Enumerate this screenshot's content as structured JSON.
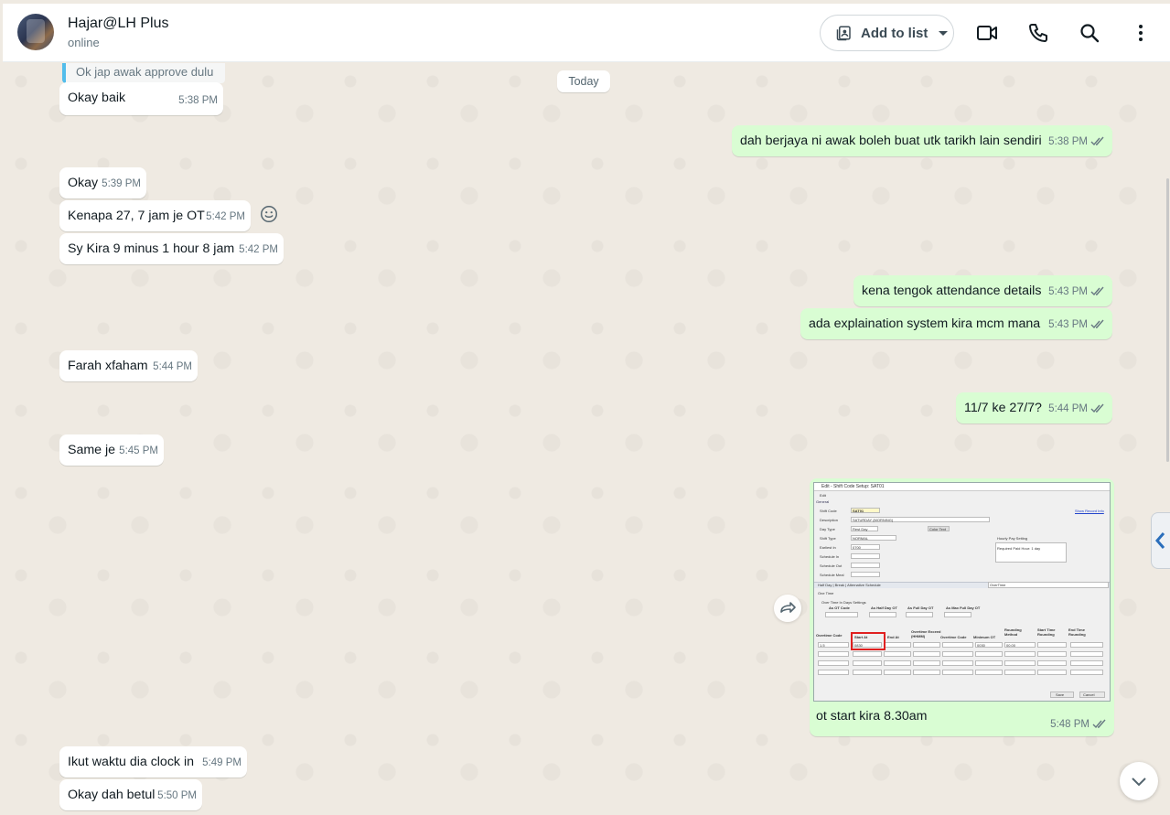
{
  "header": {
    "contact_name": "Hajar@LH Plus",
    "status": "online",
    "add_to_list_label": "Add to list",
    "icons": [
      "video-call-icon",
      "voice-call-icon",
      "search-icon",
      "menu-icon"
    ]
  },
  "chat": {
    "date_separator": "Today",
    "quoted_text": "Ok jap awak approve dulu",
    "messages": [
      {
        "dir": "in",
        "text": "Okay baik",
        "time": "5:38 PM"
      },
      {
        "dir": "out",
        "text": "dah berjaya ni awak boleh buat utk tarikh lain sendiri",
        "time": "5:38 PM"
      },
      {
        "dir": "in",
        "text": "Okay",
        "time": "5:39 PM"
      },
      {
        "dir": "in",
        "text": "Kenapa 27, 7 jam je OT",
        "time": "5:42 PM"
      },
      {
        "dir": "in",
        "text": "Sy Kira 9 minus 1 hour 8 jam",
        "time": "5:42 PM"
      },
      {
        "dir": "out",
        "text": "kena tengok attendance details",
        "time": "5:43 PM"
      },
      {
        "dir": "out",
        "text": "ada explaination system kira mcm mana",
        "time": "5:43 PM"
      },
      {
        "dir": "in",
        "text": "Farah xfaham",
        "time": "5:44 PM"
      },
      {
        "dir": "out",
        "text": "11/7 ke 27/7?",
        "time": "5:44 PM"
      },
      {
        "dir": "in",
        "text": "Same je",
        "time": "5:45 PM"
      },
      {
        "dir": "out",
        "text": "ot start kira 8.30am",
        "time": "5:48 PM"
      },
      {
        "dir": "in",
        "text": "Ikut waktu dia clock in",
        "time": "5:49 PM"
      },
      {
        "dir": "in",
        "text": "Okay dah betul",
        "time": "5:50 PM"
      }
    ]
  },
  "screenshot": {
    "window_title": "Edit - Shift Code Setup: SAT01",
    "menu": "Edit",
    "tab_general": "General",
    "shift_code_label": "Shift Code",
    "shift_code_value": "SAT01",
    "description_label": "Description",
    "description_value": "SATURDAY (MORNING)",
    "day_type_label": "Day Type",
    "day_type_value": "Rest Day",
    "color_text_btn": "Color Text",
    "shift_type_label": "Shift Type",
    "shift_type_value": "NORMAL",
    "earliest_in_label": "Earliest In",
    "earliest_in_value": "0700",
    "schedule_in_label": "Schedule In",
    "schedule_out_label": "Schedule Out",
    "schedule_meal_label": "Schedule Meal",
    "hourly_pay_label": "Hourly Pay Setting",
    "required_paid_hour_label": "Required Paid Hour: 1 day",
    "show_record_info": "Show Record Info",
    "tabs_row": "Half Day | Break | Alternative Schedule",
    "overtime_tab": "OverTime",
    "ot_section_title": "One Time",
    "ot_rest_day_label": "Over Time In Days Settings",
    "as_ot_code": "As OT Code",
    "as_half_day_ot": "As Half Day OT",
    "as_full_day_ot": "As Full Day OT",
    "as_max_full_day_ot": "As Max Full Day OT",
    "col_overtime_code": "Overtime Code",
    "col_start_at": "Start At",
    "col_end_at": "End At",
    "col_overtime_exceed": "Overtime Exceed (HHMM)",
    "col_overtime_code2": "Overtime Code",
    "col_minimum_ot": "Minimum OT",
    "col_rounding_method": "Rounding Method",
    "col_start_time_rounding": "Start Time Rounding",
    "col_end_time_rounding": "End Time Rounding",
    "row1_code": "1.5",
    "row1_start": "0830",
    "row1_min": "0030",
    "row1_round": "00.00",
    "save_btn": "Save",
    "cancel_btn": "Cancel"
  }
}
